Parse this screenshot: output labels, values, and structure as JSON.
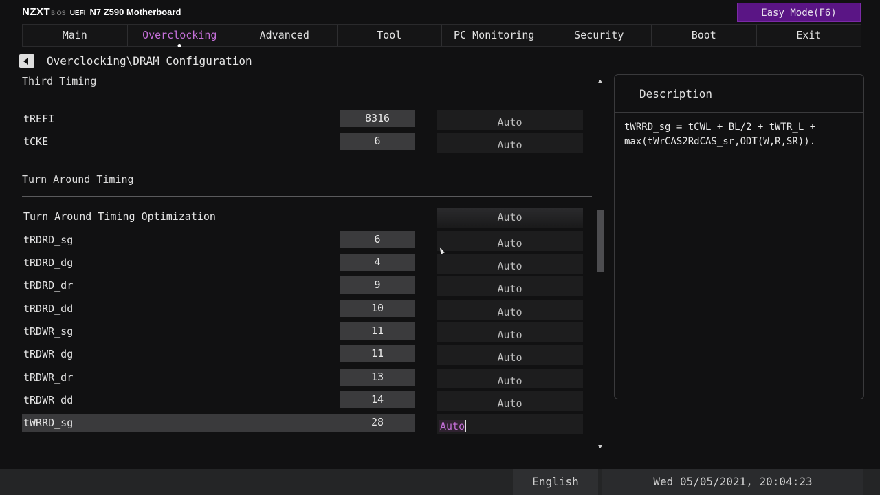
{
  "header": {
    "brand": "NZXT",
    "bios": "BIOS",
    "uefi": "UEFI",
    "model": "N7 Z590 Motherboard",
    "easy_mode_label": "Easy Mode(F6)"
  },
  "tabs": [
    {
      "label": "Main"
    },
    {
      "label": "Overclocking"
    },
    {
      "label": "Advanced"
    },
    {
      "label": "Tool"
    },
    {
      "label": "PC Monitoring"
    },
    {
      "label": "Security"
    },
    {
      "label": "Boot"
    },
    {
      "label": "Exit"
    }
  ],
  "active_tab": "Overclocking",
  "breadcrumb": "Overclocking\\DRAM Configuration",
  "sections": {
    "third_timing": "Third Timing",
    "turn_around_timing": "Turn Around Timing"
  },
  "rows": [
    {
      "label": "tREFI",
      "value": "8316",
      "setting": "Auto"
    },
    {
      "label": "tCKE",
      "value": "6",
      "setting": "Auto"
    },
    {
      "label": "Turn Around Timing Optimization",
      "value": "",
      "setting": "Auto"
    },
    {
      "label": "tRDRD_sg",
      "value": "6",
      "setting": "Auto"
    },
    {
      "label": "tRDRD_dg",
      "value": "4",
      "setting": "Auto"
    },
    {
      "label": "tRDRD_dr",
      "value": "9",
      "setting": "Auto"
    },
    {
      "label": "tRDRD_dd",
      "value": "10",
      "setting": "Auto"
    },
    {
      "label": "tRDWR_sg",
      "value": "11",
      "setting": "Auto"
    },
    {
      "label": "tRDWR_dg",
      "value": "11",
      "setting": "Auto"
    },
    {
      "label": "tRDWR_dr",
      "value": "13",
      "setting": "Auto"
    },
    {
      "label": "tRDWR_dd",
      "value": "14",
      "setting": "Auto"
    },
    {
      "label": "tWRRD_sg",
      "value": "28",
      "setting": "Auto"
    }
  ],
  "description": {
    "title": "Description",
    "text": "tWRRD_sg = tCWL + BL/2 + tWTR_L +\nmax(tWrCAS2RdCAS_sr,ODT(W,R,SR))."
  },
  "footer": {
    "language": "English",
    "datetime": "Wed 05/05/2021, 20:04:23"
  },
  "colors": {
    "accent": "#c46fd8",
    "easy_mode_bg": "#5a1585"
  }
}
